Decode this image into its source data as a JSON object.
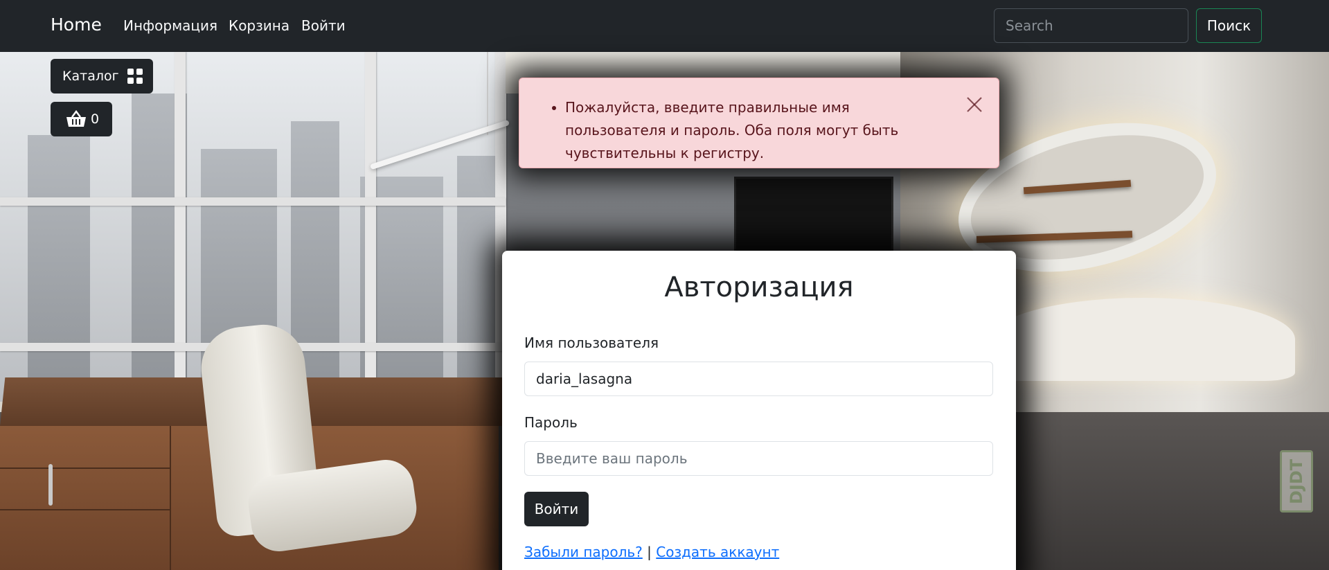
{
  "navbar": {
    "brand": "Home",
    "links": [
      "Информация",
      "Корзина",
      "Войти"
    ],
    "search_placeholder": "Search",
    "search_button": "Поиск"
  },
  "side_buttons": {
    "catalog_label": "Каталог",
    "cart_count": "0"
  },
  "alert": {
    "message": "Пожалуйста, введите правильные имя пользователя и пароль. Оба поля могут быть чувствительны к регистру."
  },
  "login": {
    "title": "Авторизация",
    "username_label": "Имя пользователя",
    "username_value": "daria_lasagna",
    "password_label": "Пароль",
    "password_placeholder": "Введите ваш пароль",
    "submit_label": "Войти",
    "forgot_link": "Забыли пароль?",
    "separator": "|",
    "register_link": "Создать аккаунт"
  },
  "background": {
    "watermark": "DJDT"
  },
  "colors": {
    "navbar": "#212529",
    "alert_bg": "#f8d7da",
    "alert_text": "#58151c",
    "link": "#0d6efd",
    "search_border": "#198754"
  }
}
